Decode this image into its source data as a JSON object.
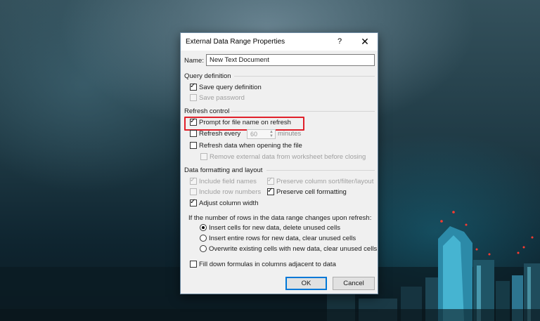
{
  "dialog": {
    "title": "External Data Range Properties",
    "help": "?",
    "close": "✕",
    "name_label": "Name:",
    "name_value": "New Text Document",
    "query_definition": {
      "heading": "Query definition",
      "save_query": {
        "label": "Save query definition",
        "checked": true
      },
      "save_password": {
        "label": "Save password",
        "checked": false
      }
    },
    "refresh_control": {
      "heading": "Refresh control",
      "prompt_file": {
        "label": "Prompt for file name on refresh",
        "checked": true
      },
      "refresh_every": {
        "label": "Refresh every",
        "value": "60",
        "unit": "minutes",
        "checked": false
      },
      "refresh_on_open": {
        "label": "Refresh data when opening the file",
        "checked": false
      },
      "remove_external": {
        "label": "Remove external data from worksheet before closing",
        "checked": false
      }
    },
    "formatting": {
      "heading": "Data formatting and layout",
      "include_field_names": {
        "label": "Include field names",
        "checked": true
      },
      "include_row_numbers": {
        "label": "Include row numbers",
        "checked": false
      },
      "adjust_column_width": {
        "label": "Adjust column width",
        "checked": true
      },
      "preserve_sort": {
        "label": "Preserve column sort/filter/layout",
        "checked": true
      },
      "preserve_cell_format": {
        "label": "Preserve cell formatting",
        "checked": true
      },
      "rows_change_prompt": "If the number of rows in the data range changes upon refresh:",
      "options": [
        {
          "label": "Insert cells for new data, delete unused cells",
          "selected": true
        },
        {
          "label": "Insert entire rows for new data, clear unused cells",
          "selected": false
        },
        {
          "label": "Overwrite existing cells with new data, clear unused cells",
          "selected": false
        }
      ],
      "fill_down": {
        "label": "Fill down formulas in columns adjacent to data",
        "checked": false
      }
    },
    "ok_label": "OK",
    "cancel_label": "Cancel"
  },
  "colors": {
    "highlight": "#e0202a",
    "accent": "#0078d7"
  }
}
